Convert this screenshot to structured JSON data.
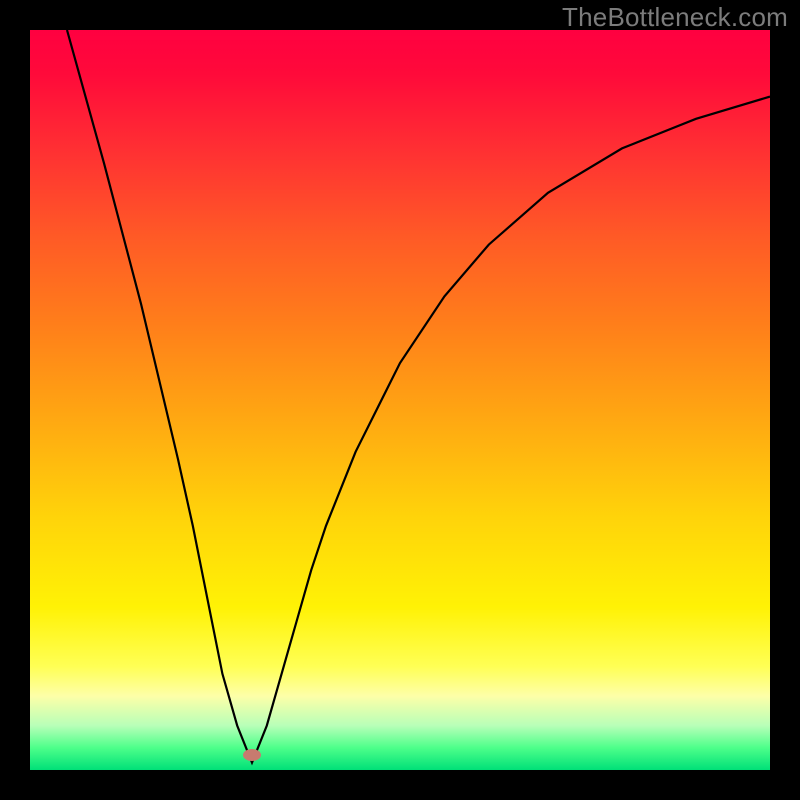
{
  "watermark": "TheBottleneck.com",
  "colors": {
    "frame_bg": "#000000",
    "curve": "#000000",
    "dot": "#c77b6f",
    "gradient_top": "#ff0040",
    "gradient_bottom": "#00e078"
  },
  "chart_data": {
    "type": "line",
    "title": "",
    "xlabel": "",
    "ylabel": "",
    "xlim": [
      0,
      100
    ],
    "ylim": [
      0,
      100
    ],
    "grid": false,
    "legend": false,
    "background": "vertical-gradient red→orange→yellow→green",
    "annotations": [
      {
        "type": "marker",
        "x": 30,
        "y": 2,
        "label": "optimal-point"
      }
    ],
    "series": [
      {
        "name": "bottleneck-curve",
        "x": [
          5,
          10,
          15,
          20,
          22,
          24,
          26,
          28,
          30,
          32,
          34,
          36,
          38,
          40,
          44,
          50,
          56,
          62,
          70,
          80,
          90,
          100
        ],
        "y": [
          100,
          82,
          63,
          42,
          33,
          23,
          13,
          6,
          1,
          6,
          13,
          20,
          27,
          33,
          43,
          55,
          64,
          71,
          78,
          84,
          88,
          91
        ]
      }
    ]
  }
}
